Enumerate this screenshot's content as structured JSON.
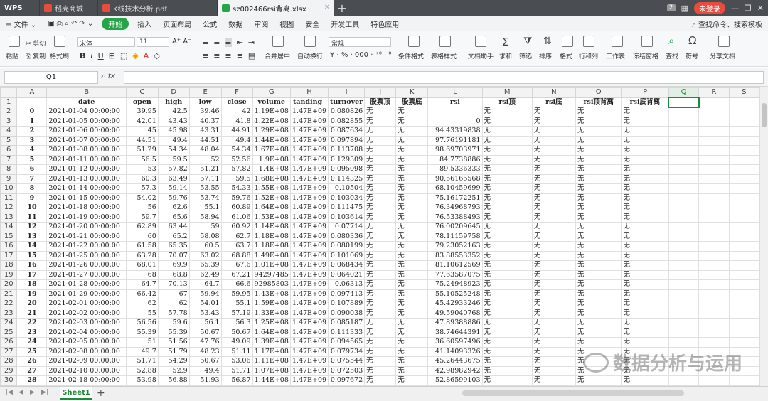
{
  "app": {
    "wps_label": "WPS",
    "tabs": [
      {
        "label": "稻壳商城",
        "color": "#e84c3d"
      },
      {
        "label": "K线技术分析.pdf",
        "color": "#e84c3d"
      },
      {
        "label": "sz002466rsi背离.xlsx",
        "color": "#27a34a"
      }
    ],
    "counter": "2",
    "login_label": "未登录"
  },
  "menu": {
    "items": [
      "文件",
      "开始",
      "插入",
      "页面布局",
      "公式",
      "数据",
      "审阅",
      "视图",
      "安全",
      "开发工具",
      "特色应用"
    ],
    "search_label": "查找命令、搜索模板"
  },
  "toolbar": {
    "paste": "粘贴",
    "cut": "剪切",
    "copy": "复制",
    "format_painter": "格式刷",
    "font_name": "宋体",
    "font_size": "11",
    "merge_center": "合并居中",
    "wrap": "自动换行",
    "number_format": "常规",
    "conditional": "条件格式",
    "table_style": "表格样式",
    "doc_helper": "文档助手",
    "sum": "求和",
    "filter": "筛选",
    "sort": "排序",
    "format": "格式",
    "row_col": "行和列",
    "worksheet": "工作表",
    "freeze": "冻结窗格",
    "find": "查找",
    "symbol": "符号",
    "share": "分享文档"
  },
  "formula_bar": {
    "cell_ref": "Q1",
    "fx": "fx",
    "content": ""
  },
  "columns": [
    "A",
    "B",
    "C",
    "D",
    "E",
    "F",
    "G",
    "H",
    "I",
    "J",
    "K",
    "L",
    "M",
    "N",
    "O",
    "P",
    "Q",
    "R",
    "S"
  ],
  "header_row": [
    "",
    "date",
    "open",
    "high",
    "low",
    "close",
    "volume",
    "tanding_",
    "turnover",
    "股票顶",
    "股票底",
    "rsi",
    "rsi顶",
    "rsi底",
    "rsi顶背离",
    "rsi底背离",
    "",
    "",
    ""
  ],
  "rows": [
    [
      "0",
      "2021-01-04 00:00:00",
      "39.95",
      "42.5",
      "39.46",
      "42",
      "1.19E+08",
      "1.47E+09",
      "0.080826",
      "无",
      "无",
      "",
      "无",
      "无",
      "无",
      "无"
    ],
    [
      "1",
      "2021-01-05 00:00:00",
      "42.01",
      "43.43",
      "40.37",
      "41.8",
      "1.22E+08",
      "1.47E+09",
      "0.082855",
      "无",
      "无",
      "0",
      "无",
      "无",
      "无",
      "无"
    ],
    [
      "2",
      "2021-01-06 00:00:00",
      "45",
      "45.98",
      "43.31",
      "44.91",
      "1.29E+08",
      "1.47E+09",
      "0.087634",
      "无",
      "无",
      "94.43319838",
      "无",
      "无",
      "无",
      "无"
    ],
    [
      "3",
      "2021-01-07 00:00:00",
      "44.51",
      "49.4",
      "44.51",
      "49.4",
      "1.44E+08",
      "1.47E+09",
      "0.097894",
      "无",
      "无",
      "97.76191181",
      "无",
      "无",
      "无",
      "无"
    ],
    [
      "4",
      "2021-01-08 00:00:00",
      "51.29",
      "54.34",
      "48.04",
      "54.34",
      "1.67E+08",
      "1.47E+09",
      "0.113708",
      "无",
      "无",
      "98.69703971",
      "无",
      "无",
      "无",
      "无"
    ],
    [
      "5",
      "2021-01-11 00:00:00",
      "56.5",
      "59.5",
      "52",
      "52.56",
      "1.9E+08",
      "1.47E+09",
      "0.129309",
      "无",
      "无",
      "84.7738886",
      "无",
      "无",
      "无",
      "无"
    ],
    [
      "6",
      "2021-01-12 00:00:00",
      "53",
      "57.82",
      "51.21",
      "57.82",
      "1.4E+08",
      "1.47E+09",
      "0.095098",
      "无",
      "无",
      "89.5336333",
      "无",
      "无",
      "无",
      "无"
    ],
    [
      "7",
      "2021-01-13 00:00:00",
      "60.3",
      "63.49",
      "57.11",
      "59.5",
      "1.68E+08",
      "1.47E+09",
      "0.114325",
      "无",
      "无",
      "90.56165568",
      "无",
      "无",
      "无",
      "无"
    ],
    [
      "8",
      "2021-01-14 00:00:00",
      "57.3",
      "59.14",
      "53.55",
      "54.33",
      "1.55E+08",
      "1.47E+09",
      "0.10504",
      "无",
      "无",
      "68.10459699",
      "无",
      "无",
      "无",
      "无"
    ],
    [
      "9",
      "2021-01-15 00:00:00",
      "54.02",
      "59.76",
      "53.74",
      "59.76",
      "1.52E+08",
      "1.47E+09",
      "0.103034",
      "无",
      "无",
      "75.16172251",
      "无",
      "无",
      "无",
      "无"
    ],
    [
      "10",
      "2021-01-18 00:00:00",
      "56",
      "62.6",
      "55.1",
      "60.89",
      "1.64E+08",
      "1.47E+09",
      "0.111475",
      "无",
      "无",
      "76.34968793",
      "无",
      "无",
      "无",
      "无"
    ],
    [
      "11",
      "2021-01-19 00:00:00",
      "59.7",
      "65.6",
      "58.94",
      "61.06",
      "1.53E+08",
      "1.47E+09",
      "0.103614",
      "无",
      "无",
      "76.53388493",
      "无",
      "无",
      "无",
      "无"
    ],
    [
      "12",
      "2021-01-20 00:00:00",
      "62.89",
      "63.44",
      "59",
      "60.92",
      "1.14E+08",
      "1.47E+09",
      "0.07714",
      "无",
      "无",
      "76.00209645",
      "无",
      "无",
      "无",
      "无"
    ],
    [
      "13",
      "2021-01-21 00:00:00",
      "60",
      "65.2",
      "58.08",
      "62.7",
      "1.18E+08",
      "1.47E+09",
      "0.080336",
      "无",
      "无",
      "78.11159758",
      "无",
      "无",
      "无",
      "无"
    ],
    [
      "14",
      "2021-01-22 00:00:00",
      "61.58",
      "65.35",
      "60.5",
      "63.7",
      "1.18E+08",
      "1.47E+09",
      "0.080199",
      "无",
      "无",
      "79.23052163",
      "无",
      "无",
      "无",
      "无"
    ],
    [
      "15",
      "2021-01-25 00:00:00",
      "63.28",
      "70.07",
      "63.02",
      "68.88",
      "1.49E+08",
      "1.47E+09",
      "0.101069",
      "无",
      "无",
      "83.88553352",
      "无",
      "无",
      "无",
      "无"
    ],
    [
      "16",
      "2021-01-26 00:00:00",
      "68.01",
      "69.9",
      "65.39",
      "67.6",
      "1.01E+08",
      "1.47E+09",
      "0.068434",
      "无",
      "无",
      "81.10612569",
      "无",
      "无",
      "无",
      "无"
    ],
    [
      "17",
      "2021-01-27 00:00:00",
      "68",
      "68.8",
      "62.49",
      "67.21",
      "94297485",
      "1.47E+09",
      "0.064021",
      "无",
      "无",
      "77.63587075",
      "无",
      "无",
      "无",
      "无"
    ],
    [
      "18",
      "2021-01-28 00:00:00",
      "64.7",
      "70.13",
      "64.7",
      "66.6",
      "92985803",
      "1.47E+09",
      "0.06313",
      "无",
      "无",
      "75.24948923",
      "无",
      "无",
      "无",
      "无"
    ],
    [
      "19",
      "2021-01-29 00:00:00",
      "66.42",
      "67",
      "59.94",
      "59.95",
      "1.43E+08",
      "1.47E+09",
      "0.097413",
      "无",
      "无",
      "55.10525248",
      "无",
      "无",
      "无",
      "无"
    ],
    [
      "20",
      "2021-02-01 00:00:00",
      "62",
      "62",
      "54.01",
      "55.1",
      "1.59E+08",
      "1.47E+09",
      "0.107889",
      "无",
      "无",
      "45.42933246",
      "无",
      "无",
      "无",
      "无"
    ],
    [
      "21",
      "2021-02-02 00:00:00",
      "55",
      "57.78",
      "53.43",
      "57.19",
      "1.33E+08",
      "1.47E+09",
      "0.090038",
      "无",
      "无",
      "49.59040768",
      "无",
      "无",
      "无",
      "无"
    ],
    [
      "22",
      "2021-02-03 00:00:00",
      "56.56",
      "59.6",
      "56.1",
      "56.3",
      "1.25E+08",
      "1.47E+09",
      "0.085187",
      "无",
      "无",
      "47.89388886",
      "无",
      "无",
      "无",
      "无"
    ],
    [
      "23",
      "2021-02-04 00:00:00",
      "55.39",
      "55.39",
      "50.67",
      "50.67",
      "1.64E+08",
      "1.47E+09",
      "0.111333",
      "无",
      "无",
      "38.74644391",
      "无",
      "无",
      "无",
      "无"
    ],
    [
      "24",
      "2021-02-05 00:00:00",
      "51",
      "51.56",
      "47.76",
      "49.09",
      "1.39E+08",
      "1.47E+09",
      "0.094565",
      "无",
      "无",
      "36.60597496",
      "无",
      "无",
      "无",
      "无"
    ],
    [
      "25",
      "2021-02-08 00:00:00",
      "49.7",
      "51.79",
      "48.23",
      "51.11",
      "1.17E+08",
      "1.47E+09",
      "0.079734",
      "无",
      "无",
      "41.14093326",
      "无",
      "无",
      "无",
      "无"
    ],
    [
      "26",
      "2021-02-09 00:00:00",
      "51.71",
      "54.29",
      "50.67",
      "53.06",
      "1.11E+08",
      "1.47E+09",
      "0.075544",
      "无",
      "无",
      "45.26443675",
      "无",
      "无",
      "无",
      "无"
    ],
    [
      "27",
      "2021-02-10 00:00:00",
      "52.88",
      "52.9",
      "49.4",
      "51.71",
      "1.07E+08",
      "1.47E+09",
      "0.072503",
      "无",
      "无",
      "42.98982942",
      "无",
      "无",
      "无",
      "无"
    ],
    [
      "28",
      "2021-02-18 00:00:00",
      "53.98",
      "56.88",
      "51.93",
      "56.87",
      "1.44E+08",
      "1.47E+09",
      "0.097672",
      "无",
      "无",
      "52.86599103",
      "无",
      "无",
      "无",
      "无"
    ]
  ],
  "sheet_tab": "Sheet1",
  "watermark": "数据分析与运用"
}
